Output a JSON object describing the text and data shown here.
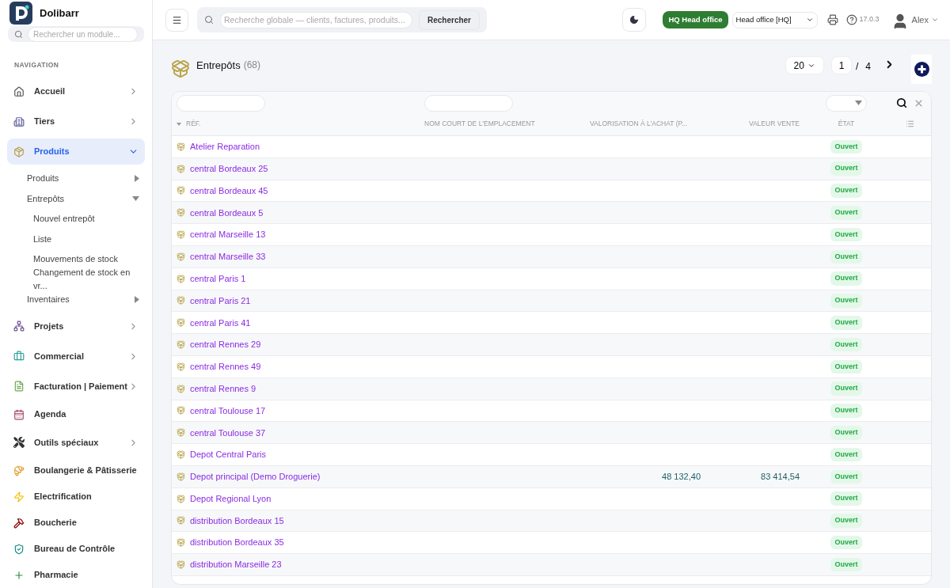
{
  "app": {
    "name": "Dolibarr"
  },
  "module_search": {
    "placeholder": "Rechercher un module..."
  },
  "nav_heading": "NAVIGATION",
  "nav": [
    {
      "label": "Accueil",
      "kind": "menu",
      "selected": false,
      "expanded": false
    },
    {
      "label": "Tiers",
      "kind": "menu",
      "selected": false,
      "expanded": false
    },
    {
      "label": "Produits",
      "kind": "menu",
      "selected": true,
      "expanded": true,
      "children": [
        {
          "label": "Produits",
          "selected": false,
          "expanded": false
        },
        {
          "label": "Entrepôts",
          "selected": false,
          "expanded": true,
          "children": [
            {
              "label": "Nouvel entrepôt",
              "selected": false
            },
            {
              "label": "Liste",
              "selected": false
            },
            {
              "label": "Mouvements de stock",
              "selected": false
            },
            {
              "label": "Changement de stock en vr...",
              "selected": false
            }
          ]
        },
        {
          "label": "Inventaires",
          "selected": false,
          "expanded": false
        }
      ]
    },
    {
      "label": "Projets",
      "kind": "menu",
      "selected": false,
      "expanded": false
    },
    {
      "label": "Commercial",
      "kind": "menu",
      "selected": false,
      "expanded": false
    },
    {
      "label": "Facturation | Paiement",
      "kind": "menu",
      "selected": false,
      "expanded": false
    },
    {
      "label": "Agenda",
      "kind": "link",
      "selected": false
    },
    {
      "label": "Outils spéciaux",
      "kind": "menu",
      "selected": false,
      "expanded": false
    },
    {
      "label": "Boulangerie & Pâtisserie",
      "kind": "link",
      "selected": false
    },
    {
      "label": "Electrification",
      "kind": "link",
      "selected": false
    },
    {
      "label": "Boucherie",
      "kind": "link",
      "selected": false
    },
    {
      "label": "Bureau de Contrôle",
      "kind": "link",
      "selected": false
    },
    {
      "label": "Pharmacie",
      "kind": "link",
      "selected": false
    }
  ],
  "header": {
    "global_search": {
      "placeholder": "Recherche globale — clients, factures, produits...",
      "button": "Rechercher"
    },
    "entity_badge": "HQ Head office",
    "entity_select": "Head office [HQ]",
    "version": "17.0.3",
    "user": "Alex"
  },
  "page": {
    "title": "Entrepôts",
    "count": "(68)",
    "per_page": "20",
    "page": "1",
    "page_sep": "/",
    "pages": "4"
  },
  "table": {
    "columns": [
      "RÉF.",
      "NOM COURT DE L'EMPLACEMENT",
      "VALORISATION À L'ACHAT (P...",
      "VALEUR VENTE",
      "ÉTAT"
    ],
    "rows": [
      {
        "ref": "Atelier Reparation",
        "status": "Ouvert"
      },
      {
        "ref": "central Bordeaux 25",
        "status": "Ouvert"
      },
      {
        "ref": "central Bordeaux 45",
        "status": "Ouvert"
      },
      {
        "ref": "central Bordeaux 5",
        "status": "Ouvert"
      },
      {
        "ref": "central Marseille 13",
        "status": "Ouvert"
      },
      {
        "ref": "central Marseille 33",
        "status": "Ouvert"
      },
      {
        "ref": "central Paris 1",
        "status": "Ouvert"
      },
      {
        "ref": "central Paris 21",
        "status": "Ouvert"
      },
      {
        "ref": "central Paris 41",
        "status": "Ouvert"
      },
      {
        "ref": "central Rennes 29",
        "status": "Ouvert"
      },
      {
        "ref": "central Rennes 49",
        "status": "Ouvert"
      },
      {
        "ref": "central Rennes 9",
        "status": "Ouvert"
      },
      {
        "ref": "central Toulouse 17",
        "status": "Ouvert"
      },
      {
        "ref": "central Toulouse 37",
        "status": "Ouvert"
      },
      {
        "ref": "Depot Central Paris",
        "status": "Ouvert"
      },
      {
        "ref": "Depot principal (Demo Droguerie)",
        "purchase_value": "48 132,40",
        "sale_value": "83 414,54",
        "status": "Ouvert"
      },
      {
        "ref": "Depot Regional Lyon",
        "status": "Ouvert"
      },
      {
        "ref": "distribution Bordeaux 15",
        "status": "Ouvert"
      },
      {
        "ref": "distribution Bordeaux 35",
        "status": "Ouvert"
      },
      {
        "ref": "distribution Marseille 23",
        "status": "Ouvert"
      }
    ]
  }
}
